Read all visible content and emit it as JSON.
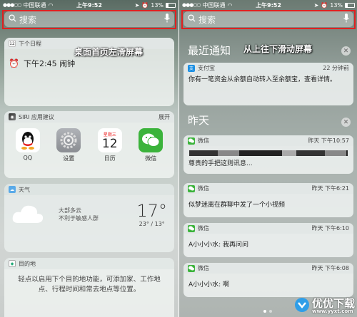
{
  "left": {
    "status": {
      "carrier": "中国联通",
      "time": "上午9:52",
      "battery": "13%"
    },
    "search": {
      "placeholder": "搜索"
    },
    "schedule": {
      "header": "下个日程",
      "day_icon": "12",
      "event": "下午2:45 闹钟"
    },
    "annotation": "桌面首页左滑屏幕",
    "siri": {
      "header": "SIRI 应用建议",
      "expand": "展开",
      "apps": [
        {
          "label": "QQ"
        },
        {
          "label": "设置"
        },
        {
          "label": "日历",
          "weekday": "星期三",
          "day": "12"
        },
        {
          "label": "微信"
        }
      ]
    },
    "weather": {
      "header": "天气",
      "condition": "大部多云",
      "tip": "不利于敏感人群",
      "temp": "17°",
      "range": "23° / 13°"
    },
    "destination": {
      "header": "目的地",
      "body": "轻点以启用下个目的地功能，可添加家、工作地点、行程时间和常去地点等位置。"
    }
  },
  "right": {
    "status": {
      "carrier": "中国联通",
      "time": "上午9:52",
      "battery": "13%"
    },
    "search": {
      "placeholder": "搜索"
    },
    "recent_title": "最近通知",
    "annotation": "从上往下滑动屏幕",
    "alipay": {
      "app": "支付宝",
      "time": "22 分钟前",
      "body": "你有一笔资金从余额自动转入至余额宝，查看详情。"
    },
    "yesterday_title": "昨天",
    "messages": [
      {
        "app": "微信",
        "time": "昨天 下午10:57",
        "body": "尊贵的手把这则讯息..."
      },
      {
        "app": "微信",
        "time": "昨天 下午6:21",
        "body": "似梦迷离在群聊中发了一个小视频"
      },
      {
        "app": "微信",
        "time": "昨天 下午6:10",
        "body": "A小小小水: 我再问问"
      },
      {
        "app": "微信",
        "time": "昨天 下午6:08",
        "body": "A小小小水: 啊"
      }
    ],
    "watermark": {
      "text": "优优下载",
      "url": "www.yyxt.com"
    }
  }
}
